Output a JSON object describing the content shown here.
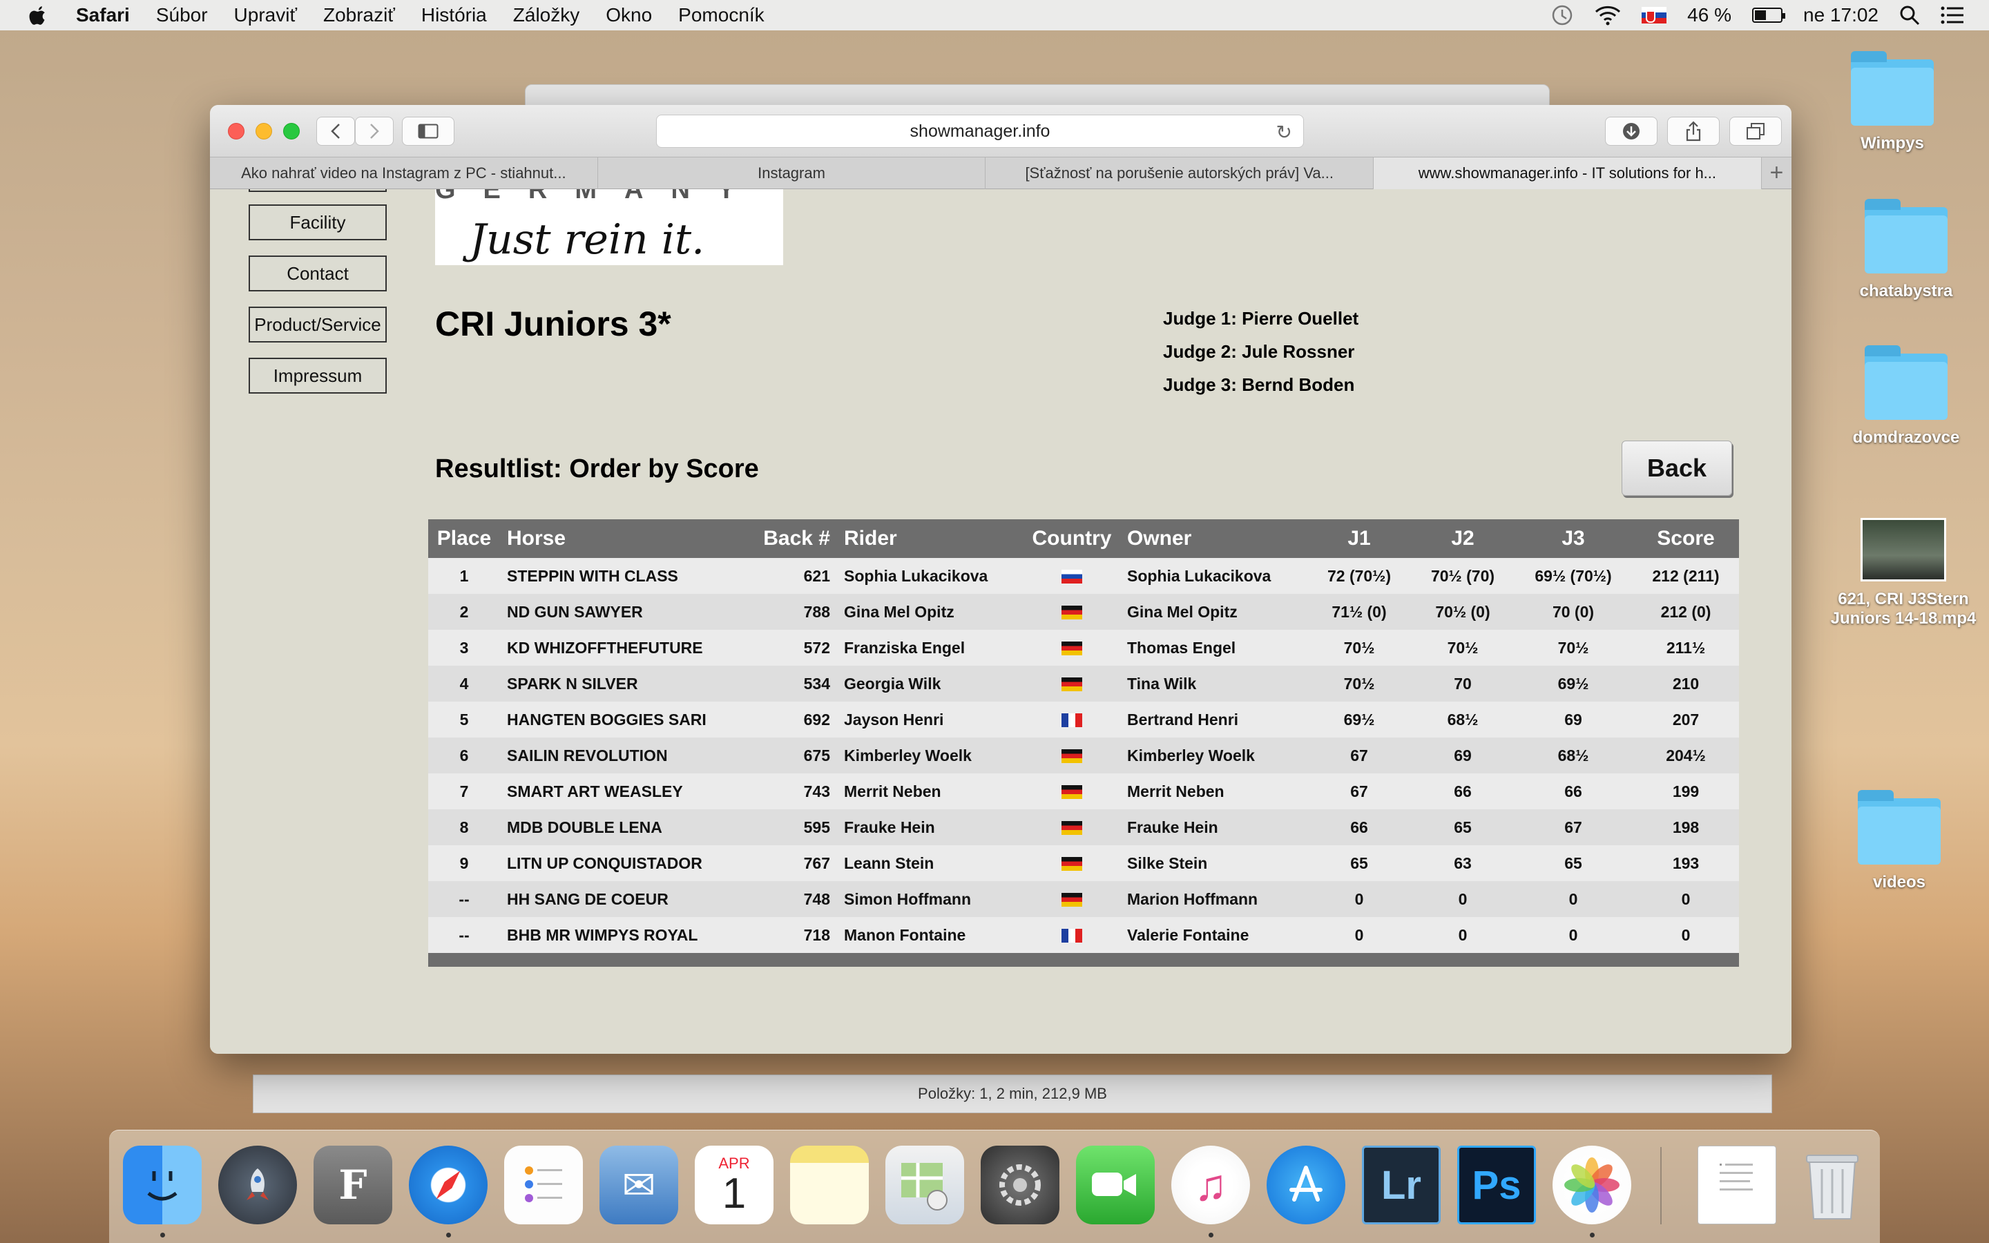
{
  "menubar": {
    "app": "Safari",
    "items": [
      "Súbor",
      "Upraviť",
      "Zobraziť",
      "História",
      "Záložky",
      "Okno",
      "Pomocník"
    ],
    "battery": "46 %",
    "clock": "ne 17:02"
  },
  "browser": {
    "url": "showmanager.info",
    "tabs": [
      "Ako nahrať video na Instagram z PC - stiahnut...",
      "Instagram",
      "[Sťažnosť na porušenie autorských práv] Va...",
      "www.showmanager.info - IT solutions for h..."
    ],
    "active_tab": 3
  },
  "sidebar": {
    "items": [
      "Facility",
      "Contact",
      "Product/Service",
      "Impressum"
    ]
  },
  "logo": {
    "country": "GERMANY",
    "slogan": "Just rein it."
  },
  "class_title": "CRI Juniors 3*",
  "judges": [
    "Judge 1: Pierre Ouellet",
    "Judge 2: Jule Rossner",
    "Judge 3: Bernd Boden"
  ],
  "result_heading": "Resultlist: Order by Score",
  "back_label": "Back",
  "columns": [
    "Place",
    "Horse",
    "Back #",
    "Rider",
    "Country",
    "Owner",
    "J1",
    "J2",
    "J3",
    "Score"
  ],
  "results": [
    {
      "place": "1",
      "horse": "STEPPIN WITH CLASS",
      "back": "621",
      "rider": "Sophia Lukacikova",
      "country": "sk",
      "owner": "Sophia Lukacikova",
      "j1": "72 (70½)",
      "j2": "70½ (70)",
      "j3": "69½ (70½)",
      "score": "212 (211)"
    },
    {
      "place": "2",
      "horse": "ND GUN SAWYER",
      "back": "788",
      "rider": "Gina Mel Opitz",
      "country": "de",
      "owner": "Gina Mel Opitz",
      "j1": "71½ (0)",
      "j2": "70½ (0)",
      "j3": "70 (0)",
      "score": "212 (0)"
    },
    {
      "place": "3",
      "horse": "KD WHIZOFFTHEFUTURE",
      "back": "572",
      "rider": "Franziska Engel",
      "country": "de",
      "owner": "Thomas Engel",
      "j1": "70½",
      "j2": "70½",
      "j3": "70½",
      "score": "211½"
    },
    {
      "place": "4",
      "horse": "SPARK N SILVER",
      "back": "534",
      "rider": "Georgia Wilk",
      "country": "de",
      "owner": "Tina Wilk",
      "j1": "70½",
      "j2": "70",
      "j3": "69½",
      "score": "210"
    },
    {
      "place": "5",
      "horse": "HANGTEN BOGGIES SARI",
      "back": "692",
      "rider": "Jayson Henri",
      "country": "fr",
      "owner": "Bertrand Henri",
      "j1": "69½",
      "j2": "68½",
      "j3": "69",
      "score": "207"
    },
    {
      "place": "6",
      "horse": "SAILIN REVOLUTION",
      "back": "675",
      "rider": "Kimberley Woelk",
      "country": "de",
      "owner": "Kimberley Woelk",
      "j1": "67",
      "j2": "69",
      "j3": "68½",
      "score": "204½"
    },
    {
      "place": "7",
      "horse": "SMART ART WEASLEY",
      "back": "743",
      "rider": "Merrit Neben",
      "country": "de",
      "owner": "Merrit Neben",
      "j1": "67",
      "j2": "66",
      "j3": "66",
      "score": "199"
    },
    {
      "place": "8",
      "horse": "MDB DOUBLE LENA",
      "back": "595",
      "rider": "Frauke Hein",
      "country": "de",
      "owner": "Frauke Hein",
      "j1": "66",
      "j2": "65",
      "j3": "67",
      "score": "198"
    },
    {
      "place": "9",
      "horse": "LITN UP CONQUISTADOR",
      "back": "767",
      "rider": "Leann Stein",
      "country": "de",
      "owner": "Silke Stein",
      "j1": "65",
      "j2": "63",
      "j3": "65",
      "score": "193"
    },
    {
      "place": "--",
      "horse": "HH SANG DE COEUR",
      "back": "748",
      "rider": "Simon Hoffmann",
      "country": "de",
      "owner": "Marion Hoffmann",
      "j1": "0",
      "j2": "0",
      "j3": "0",
      "score": "0"
    },
    {
      "place": "--",
      "horse": "BHB MR WIMPYS ROYAL",
      "back": "718",
      "rider": "Manon Fontaine",
      "country": "fr",
      "owner": "Valerie Fontaine",
      "j1": "0",
      "j2": "0",
      "j3": "0",
      "score": "0"
    }
  ],
  "finder_status": "Položky: 1, 2 min, 212,9 MB",
  "desktop_icons": [
    "Wimpys",
    "chatabystra",
    "domdrazovce",
    "621, CRI J3Stern Juniors 14-18.mp4",
    "videos"
  ],
  "dock": {
    "calendar_month": "APR",
    "calendar_day": "1"
  }
}
